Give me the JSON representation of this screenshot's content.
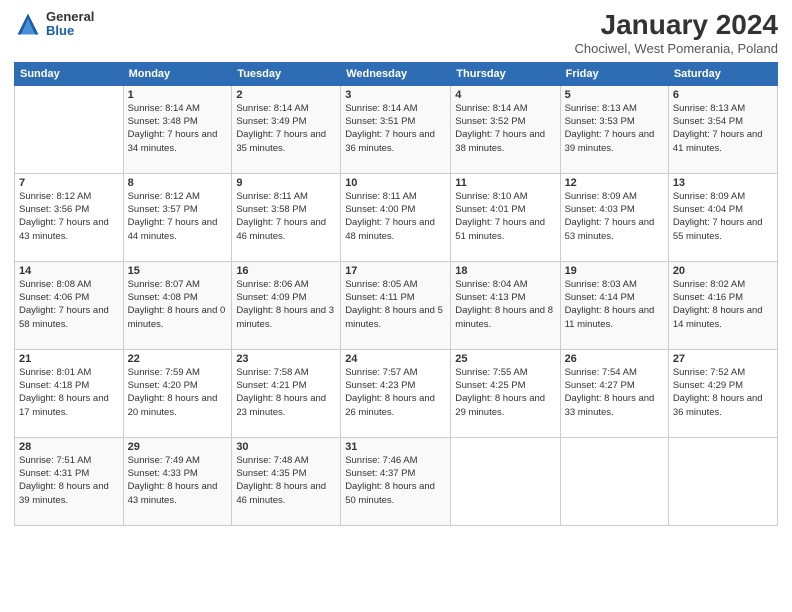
{
  "header": {
    "logo": {
      "general": "General",
      "blue": "Blue"
    },
    "title": "January 2024",
    "subtitle": "Chociwel, West Pomerania, Poland"
  },
  "weekdays": [
    "Sunday",
    "Monday",
    "Tuesday",
    "Wednesday",
    "Thursday",
    "Friday",
    "Saturday"
  ],
  "weeks": [
    [
      {
        "day": "",
        "sunrise": "",
        "sunset": "",
        "daylight": ""
      },
      {
        "day": "1",
        "sunrise": "Sunrise: 8:14 AM",
        "sunset": "Sunset: 3:48 PM",
        "daylight": "Daylight: 7 hours and 34 minutes."
      },
      {
        "day": "2",
        "sunrise": "Sunrise: 8:14 AM",
        "sunset": "Sunset: 3:49 PM",
        "daylight": "Daylight: 7 hours and 35 minutes."
      },
      {
        "day": "3",
        "sunrise": "Sunrise: 8:14 AM",
        "sunset": "Sunset: 3:51 PM",
        "daylight": "Daylight: 7 hours and 36 minutes."
      },
      {
        "day": "4",
        "sunrise": "Sunrise: 8:14 AM",
        "sunset": "Sunset: 3:52 PM",
        "daylight": "Daylight: 7 hours and 38 minutes."
      },
      {
        "day": "5",
        "sunrise": "Sunrise: 8:13 AM",
        "sunset": "Sunset: 3:53 PM",
        "daylight": "Daylight: 7 hours and 39 minutes."
      },
      {
        "day": "6",
        "sunrise": "Sunrise: 8:13 AM",
        "sunset": "Sunset: 3:54 PM",
        "daylight": "Daylight: 7 hours and 41 minutes."
      }
    ],
    [
      {
        "day": "7",
        "sunrise": "Sunrise: 8:12 AM",
        "sunset": "Sunset: 3:56 PM",
        "daylight": "Daylight: 7 hours and 43 minutes."
      },
      {
        "day": "8",
        "sunrise": "Sunrise: 8:12 AM",
        "sunset": "Sunset: 3:57 PM",
        "daylight": "Daylight: 7 hours and 44 minutes."
      },
      {
        "day": "9",
        "sunrise": "Sunrise: 8:11 AM",
        "sunset": "Sunset: 3:58 PM",
        "daylight": "Daylight: 7 hours and 46 minutes."
      },
      {
        "day": "10",
        "sunrise": "Sunrise: 8:11 AM",
        "sunset": "Sunset: 4:00 PM",
        "daylight": "Daylight: 7 hours and 48 minutes."
      },
      {
        "day": "11",
        "sunrise": "Sunrise: 8:10 AM",
        "sunset": "Sunset: 4:01 PM",
        "daylight": "Daylight: 7 hours and 51 minutes."
      },
      {
        "day": "12",
        "sunrise": "Sunrise: 8:09 AM",
        "sunset": "Sunset: 4:03 PM",
        "daylight": "Daylight: 7 hours and 53 minutes."
      },
      {
        "day": "13",
        "sunrise": "Sunrise: 8:09 AM",
        "sunset": "Sunset: 4:04 PM",
        "daylight": "Daylight: 7 hours and 55 minutes."
      }
    ],
    [
      {
        "day": "14",
        "sunrise": "Sunrise: 8:08 AM",
        "sunset": "Sunset: 4:06 PM",
        "daylight": "Daylight: 7 hours and 58 minutes."
      },
      {
        "day": "15",
        "sunrise": "Sunrise: 8:07 AM",
        "sunset": "Sunset: 4:08 PM",
        "daylight": "Daylight: 8 hours and 0 minutes."
      },
      {
        "day": "16",
        "sunrise": "Sunrise: 8:06 AM",
        "sunset": "Sunset: 4:09 PM",
        "daylight": "Daylight: 8 hours and 3 minutes."
      },
      {
        "day": "17",
        "sunrise": "Sunrise: 8:05 AM",
        "sunset": "Sunset: 4:11 PM",
        "daylight": "Daylight: 8 hours and 5 minutes."
      },
      {
        "day": "18",
        "sunrise": "Sunrise: 8:04 AM",
        "sunset": "Sunset: 4:13 PM",
        "daylight": "Daylight: 8 hours and 8 minutes."
      },
      {
        "day": "19",
        "sunrise": "Sunrise: 8:03 AM",
        "sunset": "Sunset: 4:14 PM",
        "daylight": "Daylight: 8 hours and 11 minutes."
      },
      {
        "day": "20",
        "sunrise": "Sunrise: 8:02 AM",
        "sunset": "Sunset: 4:16 PM",
        "daylight": "Daylight: 8 hours and 14 minutes."
      }
    ],
    [
      {
        "day": "21",
        "sunrise": "Sunrise: 8:01 AM",
        "sunset": "Sunset: 4:18 PM",
        "daylight": "Daylight: 8 hours and 17 minutes."
      },
      {
        "day": "22",
        "sunrise": "Sunrise: 7:59 AM",
        "sunset": "Sunset: 4:20 PM",
        "daylight": "Daylight: 8 hours and 20 minutes."
      },
      {
        "day": "23",
        "sunrise": "Sunrise: 7:58 AM",
        "sunset": "Sunset: 4:21 PM",
        "daylight": "Daylight: 8 hours and 23 minutes."
      },
      {
        "day": "24",
        "sunrise": "Sunrise: 7:57 AM",
        "sunset": "Sunset: 4:23 PM",
        "daylight": "Daylight: 8 hours and 26 minutes."
      },
      {
        "day": "25",
        "sunrise": "Sunrise: 7:55 AM",
        "sunset": "Sunset: 4:25 PM",
        "daylight": "Daylight: 8 hours and 29 minutes."
      },
      {
        "day": "26",
        "sunrise": "Sunrise: 7:54 AM",
        "sunset": "Sunset: 4:27 PM",
        "daylight": "Daylight: 8 hours and 33 minutes."
      },
      {
        "day": "27",
        "sunrise": "Sunrise: 7:52 AM",
        "sunset": "Sunset: 4:29 PM",
        "daylight": "Daylight: 8 hours and 36 minutes."
      }
    ],
    [
      {
        "day": "28",
        "sunrise": "Sunrise: 7:51 AM",
        "sunset": "Sunset: 4:31 PM",
        "daylight": "Daylight: 8 hours and 39 minutes."
      },
      {
        "day": "29",
        "sunrise": "Sunrise: 7:49 AM",
        "sunset": "Sunset: 4:33 PM",
        "daylight": "Daylight: 8 hours and 43 minutes."
      },
      {
        "day": "30",
        "sunrise": "Sunrise: 7:48 AM",
        "sunset": "Sunset: 4:35 PM",
        "daylight": "Daylight: 8 hours and 46 minutes."
      },
      {
        "day": "31",
        "sunrise": "Sunrise: 7:46 AM",
        "sunset": "Sunset: 4:37 PM",
        "daylight": "Daylight: 8 hours and 50 minutes."
      },
      {
        "day": "",
        "sunrise": "",
        "sunset": "",
        "daylight": ""
      },
      {
        "day": "",
        "sunrise": "",
        "sunset": "",
        "daylight": ""
      },
      {
        "day": "",
        "sunrise": "",
        "sunset": "",
        "daylight": ""
      }
    ]
  ]
}
